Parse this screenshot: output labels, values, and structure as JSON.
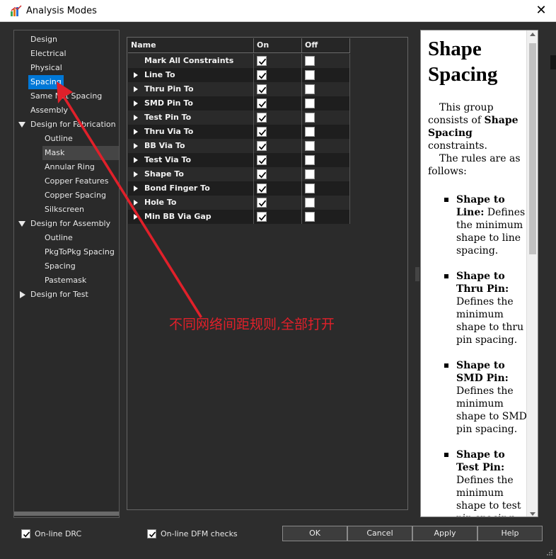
{
  "window": {
    "title": "Analysis Modes",
    "close_glyph": "✕"
  },
  "tree": {
    "items": [
      {
        "label": "Design",
        "level": 0,
        "expander": "none",
        "state": "normal"
      },
      {
        "label": "Electrical",
        "level": 0,
        "expander": "none",
        "state": "normal"
      },
      {
        "label": "Physical",
        "level": 0,
        "expander": "none",
        "state": "normal"
      },
      {
        "label": "Spacing",
        "level": 0,
        "expander": "none",
        "state": "selected"
      },
      {
        "label": "Same Net Spacing",
        "level": 0,
        "expander": "none",
        "state": "normal"
      },
      {
        "label": "Assembly",
        "level": 0,
        "expander": "none",
        "state": "normal"
      },
      {
        "label": "Design for Fabrication",
        "level": 0,
        "expander": "expanded",
        "state": "normal"
      },
      {
        "label": "Outline",
        "level": 1,
        "expander": "none",
        "state": "normal"
      },
      {
        "label": "Mask",
        "level": 1,
        "expander": "none",
        "state": "highlighted"
      },
      {
        "label": "Annular Ring",
        "level": 1,
        "expander": "none",
        "state": "normal"
      },
      {
        "label": "Copper Features",
        "level": 1,
        "expander": "none",
        "state": "normal"
      },
      {
        "label": "Copper Spacing",
        "level": 1,
        "expander": "none",
        "state": "normal"
      },
      {
        "label": "Silkscreen",
        "level": 1,
        "expander": "none",
        "state": "normal"
      },
      {
        "label": "Design for Assembly",
        "level": 0,
        "expander": "expanded",
        "state": "normal"
      },
      {
        "label": "Outline",
        "level": 1,
        "expander": "none",
        "state": "normal"
      },
      {
        "label": "PkgToPkg Spacing",
        "level": 1,
        "expander": "none",
        "state": "normal"
      },
      {
        "label": "Spacing",
        "level": 1,
        "expander": "none",
        "state": "normal"
      },
      {
        "label": "Pastemask",
        "level": 1,
        "expander": "none",
        "state": "normal"
      },
      {
        "label": "Design for Test",
        "level": 0,
        "expander": "collapsed",
        "state": "normal"
      }
    ]
  },
  "grid": {
    "columns": {
      "name": "Name",
      "on": "On",
      "off": "Off"
    },
    "rows": [
      {
        "name": "Mark All Constraints",
        "expandable": false,
        "on": true,
        "off": false
      },
      {
        "name": "Line To",
        "expandable": true,
        "on": true,
        "off": false
      },
      {
        "name": "Thru Pin To",
        "expandable": true,
        "on": true,
        "off": false
      },
      {
        "name": "SMD Pin To",
        "expandable": true,
        "on": true,
        "off": false
      },
      {
        "name": "Test Pin To",
        "expandable": true,
        "on": true,
        "off": false
      },
      {
        "name": "Thru Via To",
        "expandable": true,
        "on": true,
        "off": false
      },
      {
        "name": "BB Via To",
        "expandable": true,
        "on": true,
        "off": false
      },
      {
        "name": "Test Via To",
        "expandable": true,
        "on": true,
        "off": false
      },
      {
        "name": "Shape To",
        "expandable": true,
        "on": true,
        "off": false
      },
      {
        "name": "Bond Finger To",
        "expandable": true,
        "on": true,
        "off": false
      },
      {
        "name": "Hole To",
        "expandable": true,
        "on": true,
        "off": false
      },
      {
        "name": "Min BB Via Gap",
        "expandable": true,
        "on": true,
        "off": false
      }
    ]
  },
  "help": {
    "title": "Shape Spacing",
    "intro_1a": "This group consists of ",
    "intro_1b": "Shape Spacing",
    "intro_1c": " constraints.",
    "intro_2": "The rules are as follows:",
    "items": [
      {
        "term": "Shape to Line:",
        "desc": " Defines the minimum shape to line spacing."
      },
      {
        "term": "Shape to Thru Pin:",
        "desc": " Defines the minimum shape to thru pin spacing."
      },
      {
        "term": "Shape to SMD Pin:",
        "desc": " Defines the minimum shape to SMD pin spacing."
      },
      {
        "term": "Shape to Test Pin:",
        "desc": " Defines the minimum shape to test pin spacing."
      }
    ]
  },
  "footer": {
    "online_drc": {
      "label": "On-line DRC",
      "checked": true
    },
    "online_dfm": {
      "label": "On-line DFM checks",
      "checked": true
    },
    "buttons": {
      "ok": "OK",
      "cancel": "Cancel",
      "apply": "Apply",
      "help": "Help"
    }
  },
  "annotation": {
    "text": "不同网络间距规则,全部打开",
    "color": "#e0202a"
  }
}
